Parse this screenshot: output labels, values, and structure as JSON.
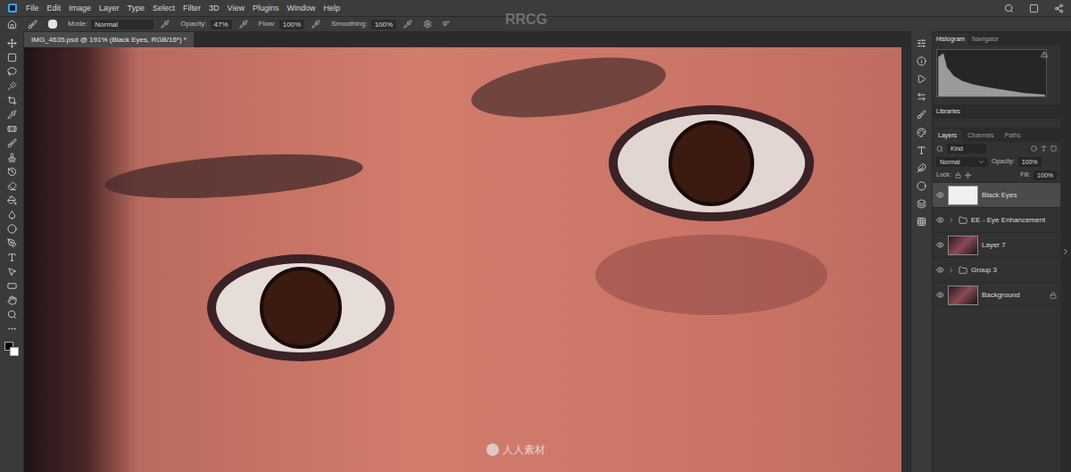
{
  "menu": [
    "File",
    "Edit",
    "Image",
    "Layer",
    "Type",
    "Select",
    "Filter",
    "3D",
    "View",
    "Plugins",
    "Window",
    "Help"
  ],
  "options": [
    {
      "label": "Mode:",
      "value": "Normal"
    },
    {
      "label": "Opacity:",
      "value": "47%"
    },
    {
      "label": "Flow:",
      "value": "100%"
    },
    {
      "label": "Smoothing:",
      "value": "100%"
    }
  ],
  "angle": "0°",
  "document_tab": {
    "title": "IMG_4635.psd @ 191% (Black Eyes, RGB/16*) *",
    "selected": true
  },
  "panels": {
    "top_tabs": [
      {
        "label": "Histogram",
        "selected": true
      },
      {
        "label": "Navigator",
        "selected": false
      }
    ],
    "libraries": "Libraries",
    "layer_tabs": [
      {
        "label": "Layers",
        "selected": true
      },
      {
        "label": "Channels",
        "selected": false
      },
      {
        "label": "Paths",
        "selected": false
      }
    ],
    "filter": "Kind",
    "blend_mode": "Normal",
    "opacity_label": "Opacity:",
    "opacity": "100%",
    "lock_label": "Lock:",
    "fill_label": "Fill:",
    "fill": "100%"
  },
  "layers": [
    {
      "name": "Black Eyes",
      "kind": "layer",
      "visible": true,
      "selected": true,
      "locked": false
    },
    {
      "name": "EE - Eye Enhancement",
      "kind": "group",
      "visible": true,
      "selected": false,
      "locked": false
    },
    {
      "name": "Layer 7",
      "kind": "layer",
      "visible": true,
      "selected": false,
      "locked": false
    },
    {
      "name": "Group 3",
      "kind": "group",
      "visible": true,
      "selected": false,
      "locked": false
    },
    {
      "name": "Background",
      "kind": "layer",
      "visible": true,
      "selected": false,
      "locked": true
    }
  ],
  "watermarks": [
    "RRCG",
    "人人素材"
  ]
}
